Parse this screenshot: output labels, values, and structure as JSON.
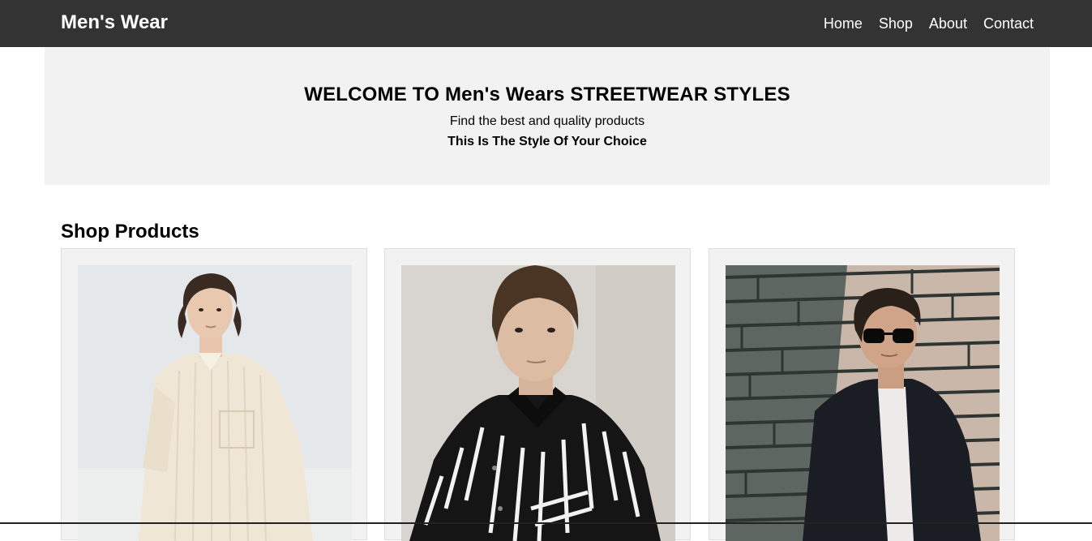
{
  "header": {
    "brand": "Men's Wear",
    "nav": [
      "Home",
      "Shop",
      "About",
      "Contact"
    ]
  },
  "hero": {
    "title": "WELCOME TO Men's Wears STREETWEAR STYLES",
    "subtitle": "Find the best and quality products",
    "tagline": "This Is The Style Of Your Choice"
  },
  "shop": {
    "title": "Shop Products",
    "products": [
      {
        "image": "man-cream-striped-shirt-photo"
      },
      {
        "image": "man-black-white-striped-shirt-photo"
      },
      {
        "image": "man-sunglasses-dark-shirt-photo"
      }
    ]
  },
  "colors": {
    "navbar": "#333333",
    "hero_bg": "#f2f2f2",
    "card_bg": "#f2f2f2"
  }
}
